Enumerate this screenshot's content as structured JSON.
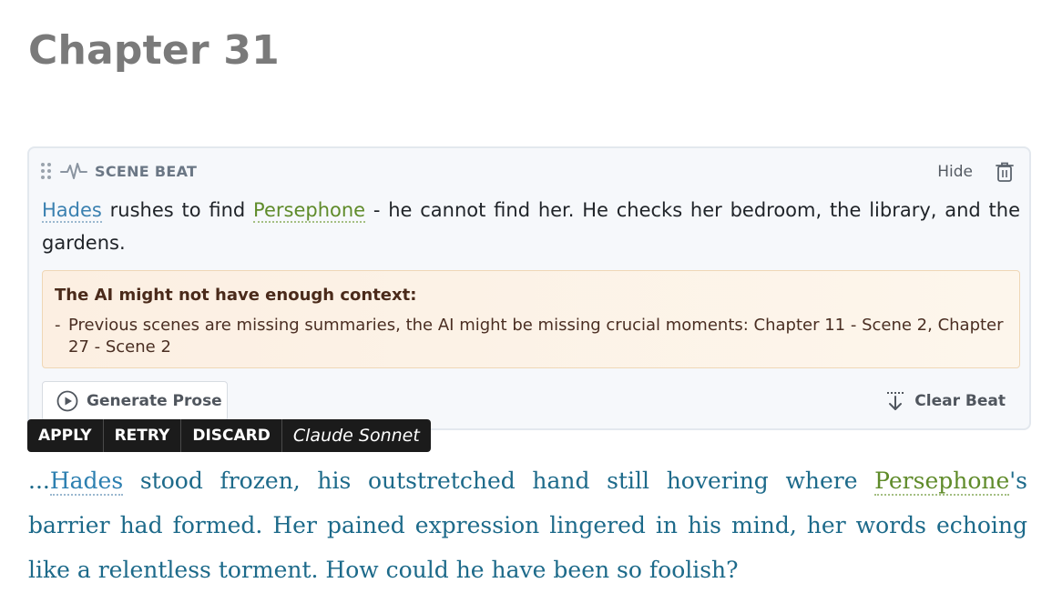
{
  "chapter": {
    "title": "Chapter 31"
  },
  "scene_beat": {
    "label": "SCENE BEAT",
    "hide_label": "Hide",
    "text": {
      "entity1": "Hades",
      "part1": " rushes to find ",
      "entity2": "Persephone",
      "part2": " - he cannot find her. He checks her bedroom, the library, and the gardens."
    },
    "warning": {
      "title": "The AI might not have enough context:",
      "dash": "-",
      "item": "Previous scenes are missing summaries, the AI might be missing crucial moments: Chapter 11 - Scene 2, Chapter 27 - Scene 2"
    },
    "generate_label": "Generate Prose",
    "clear_label": "Clear Beat"
  },
  "action_bar": {
    "apply": "APPLY",
    "retry": "RETRY",
    "discard": "DISCARD",
    "model": "Claude Sonnet"
  },
  "prose": {
    "prefix": "...",
    "entity1": "Hades",
    "part1": " stood frozen, his outstretched hand still hovering where ",
    "entity2": "Persephone",
    "part2": "'s barrier had formed. Her pained expression lingered in his mind, her words echoing like a relentless torment. How could he have been so foolish?"
  },
  "colors": {
    "entity_character": "#3a80b0",
    "entity_character_alt": "#5f8b2a",
    "prose_text": "#1d6a8a",
    "warning_bg": "#fcefe2"
  },
  "icons": [
    "drag-handle-icon",
    "pulse-icon",
    "trash-icon",
    "play-circle-icon",
    "clear-beat-icon"
  ]
}
